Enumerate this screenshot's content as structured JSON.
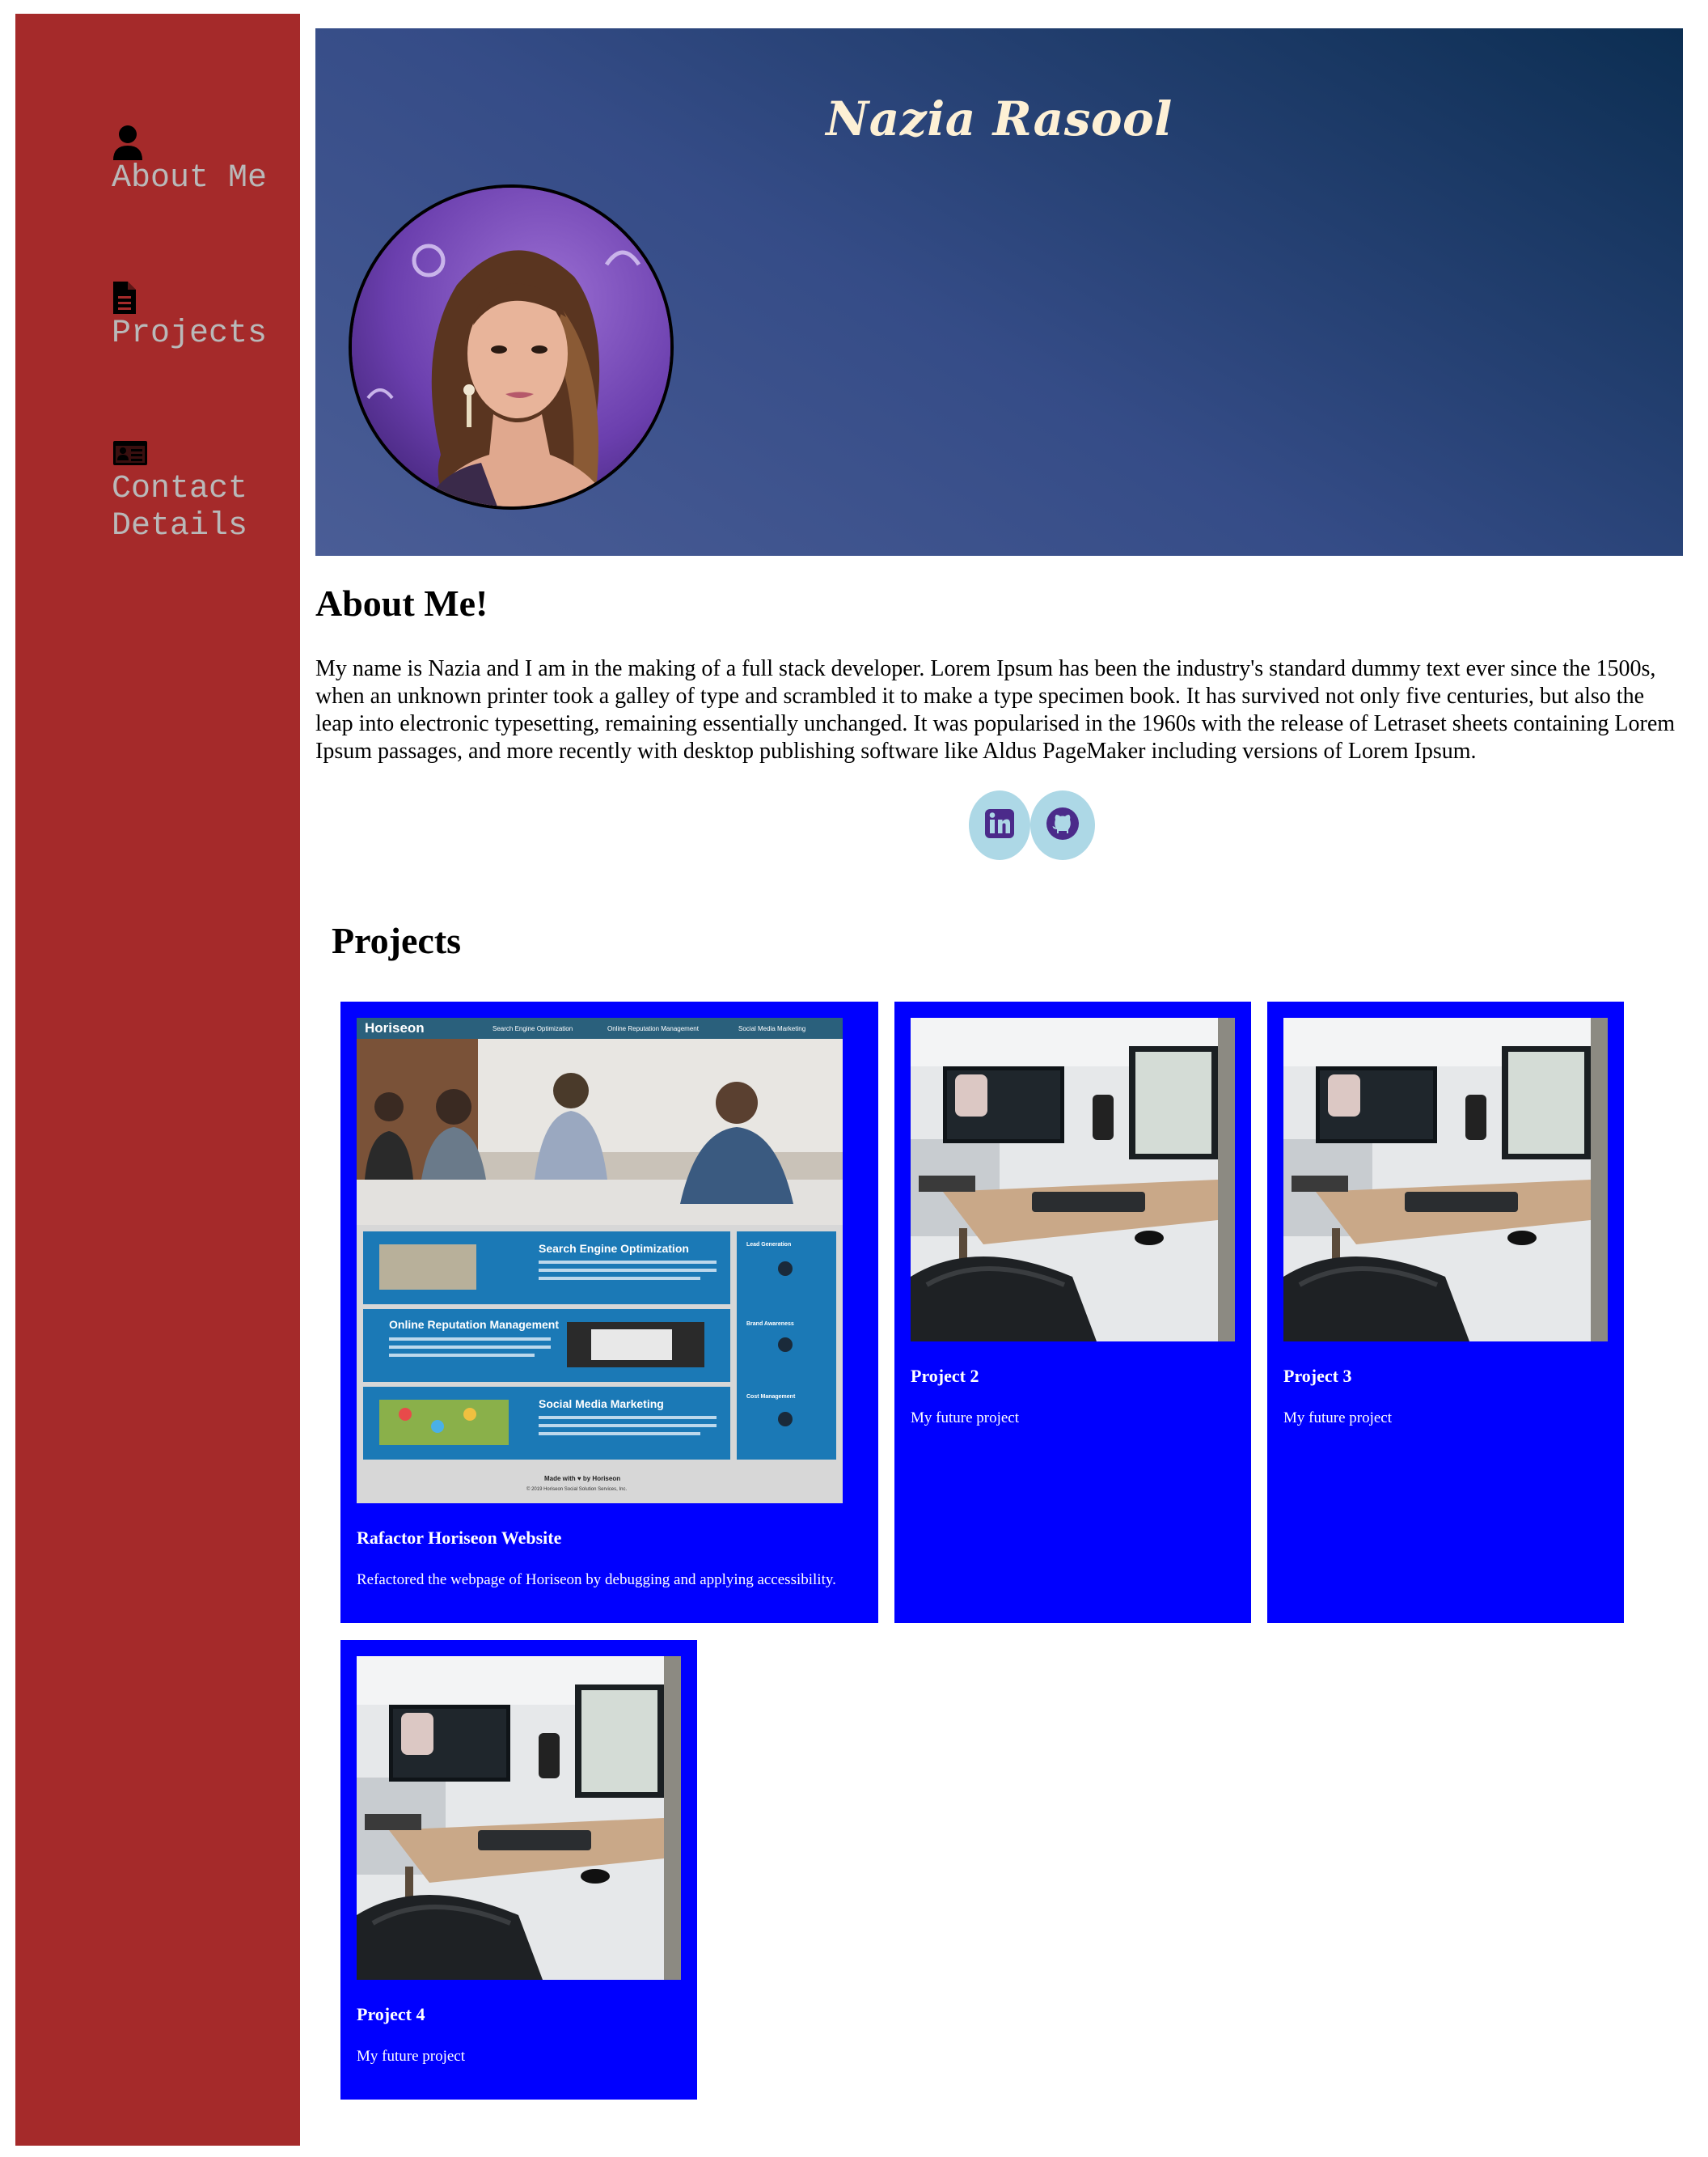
{
  "colors": {
    "sidebar_bg": "#a52a2a",
    "nav_text": "#b9b9b9",
    "header_gradient": [
      "#4a5d96",
      "#0c2e52"
    ],
    "header_title": "#fdf0d5",
    "card_bg": "#0000ff",
    "social_bg": "#add8e6",
    "social_icon": "#4b2a8a"
  },
  "sidebar": {
    "items": [
      {
        "label": "About Me",
        "icon": "user-icon"
      },
      {
        "label": "Projects",
        "icon": "file-icon"
      },
      {
        "label": "Contact\nDetails",
        "icon": "id-card-icon"
      }
    ]
  },
  "header": {
    "name": "Nazia Rasool"
  },
  "about": {
    "title": "About Me!",
    "text": "My name is Nazia and I am in the making of a full stack developer. Lorem Ipsum has been the industry's standard dummy text ever since the 1500s, when an unknown printer took a galley of type and scrambled it to make a type specimen book. It has survived not only five centuries, but also the leap into electronic typesetting, remaining essentially unchanged. It was popularised in the 1960s with the release of Letraset sheets containing Lorem Ipsum passages, and more recently with desktop publishing software like Aldus PageMaker including versions of Lorem Ipsum.",
    "social": [
      {
        "icon": "linkedin-icon"
      },
      {
        "icon": "github-icon"
      }
    ]
  },
  "projects": {
    "title": "Projects",
    "items": [
      {
        "title": "Rafactor Horiseon Website",
        "desc": "Refactored the webpage of Horiseon by debugging and applying accessibility.",
        "thumb": {
          "brand": "Horiseon",
          "nav": [
            "Search Engine Optimization",
            "Online Reputation Management",
            "Social Media Marketing"
          ],
          "sections": [
            "Search Engine Optimization",
            "Online Reputation Management",
            "Social Media Marketing"
          ],
          "aside": [
            "Lead Generation",
            "Brand Awareness",
            "Cost Management"
          ],
          "footer": "Made with ♥ by Horiseon",
          "copyright": "© 2019 Horiseon Social Solution Services, Inc."
        }
      },
      {
        "title": "Project 2",
        "desc": "My future project"
      },
      {
        "title": "Project 3",
        "desc": "My future project"
      },
      {
        "title": "Project 4",
        "desc": "My future project"
      }
    ]
  }
}
